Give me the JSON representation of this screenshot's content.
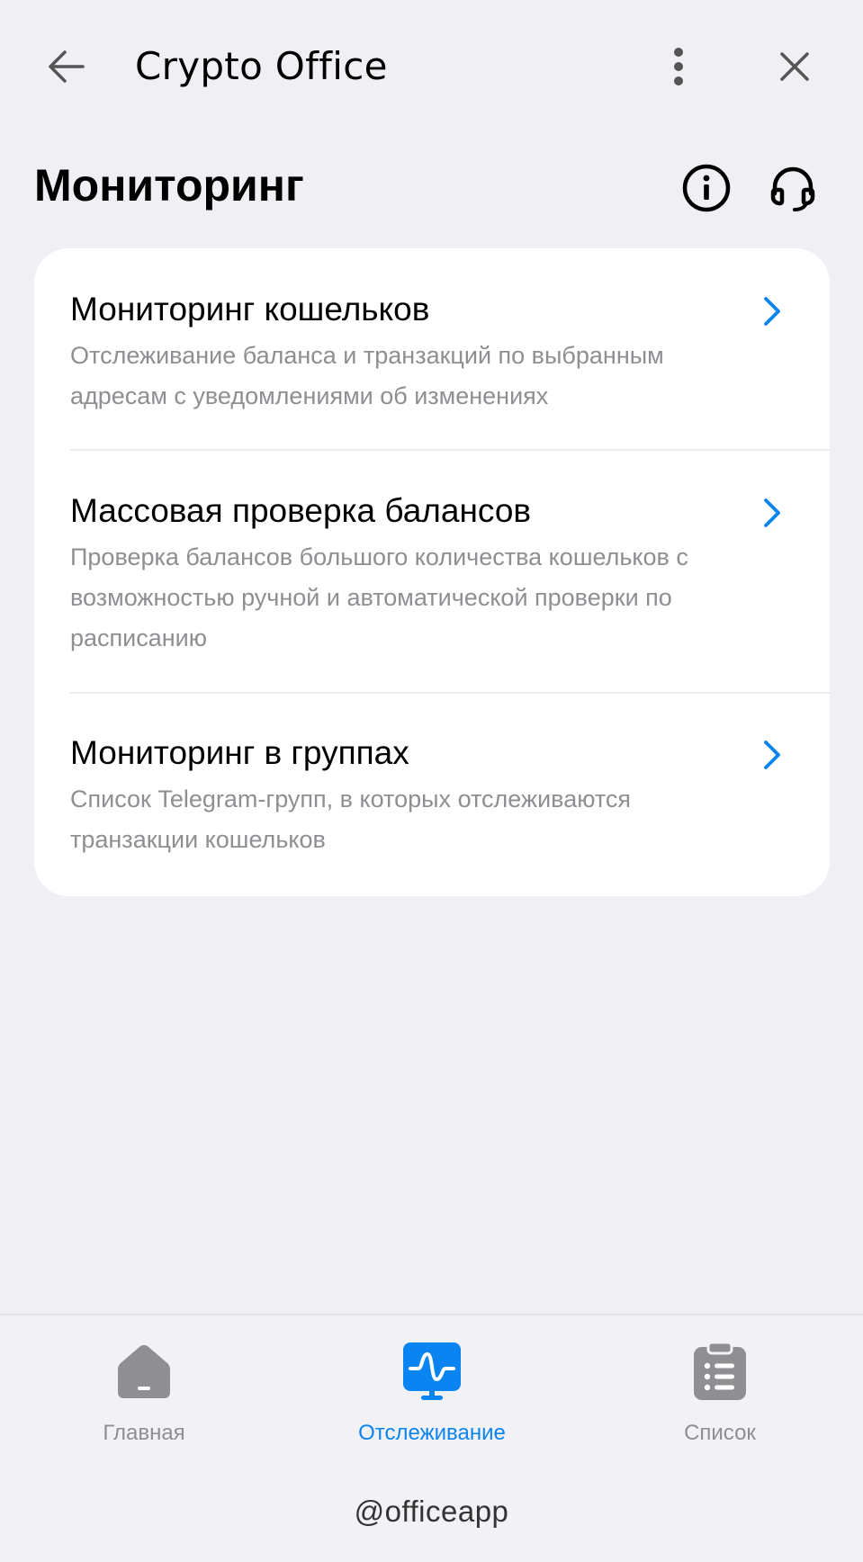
{
  "header": {
    "app_title": "Crypto Office",
    "back_icon": "arrow-left-icon",
    "menu_icon": "more-vertical-icon",
    "close_icon": "close-icon"
  },
  "page": {
    "title": "Мониторинг",
    "info_icon": "info-icon",
    "support_icon": "headset-icon"
  },
  "items": [
    {
      "title": "Мониторинг кошельков",
      "description": "Отслеживание баланса и транзакций по выбранным адресам с уведомлениями об изменениях"
    },
    {
      "title": "Массовая проверка балансов",
      "description": "Проверка балансов большого количества кошельков с возможностью ручной и автоматической проверки по расписанию"
    },
    {
      "title": "Мониторинг в группах",
      "description": "Список Telegram-групп, в которых отслеживаются транзакции кошельков"
    }
  ],
  "bottom_nav": {
    "items": [
      {
        "label": "Главная",
        "icon": "home-icon",
        "active": false
      },
      {
        "label": "Отслеживание",
        "icon": "monitor-wave-icon",
        "active": true
      },
      {
        "label": "Список",
        "icon": "clipboard-list-icon",
        "active": false
      }
    ],
    "bot_handle": "@officeapp"
  },
  "colors": {
    "background": "#efeff4",
    "card": "#ffffff",
    "accent": "#0a84f0",
    "secondary_text": "#8e8e93",
    "inactive_icon": "#8e8e93"
  }
}
